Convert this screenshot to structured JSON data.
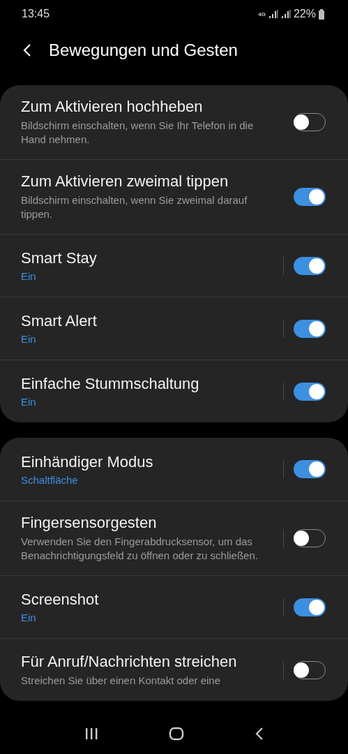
{
  "status_bar": {
    "time": "13:45",
    "network": "4G",
    "battery": "22%"
  },
  "header": {
    "title": "Bewegungen und Gesten"
  },
  "sections": [
    {
      "items": [
        {
          "kind": "plain",
          "title": "Zum Aktivieren hochheben",
          "description": "Bildschirm einschalten, wenn Sie Ihr Telefon in die Hand nehmen.",
          "on": false
        },
        {
          "kind": "plain",
          "title": "Zum Aktivieren zweimal tippen",
          "description": "Bildschirm einschalten, wenn Sie zweimal darauf tippen.",
          "on": true
        },
        {
          "kind": "link",
          "title": "Smart Stay",
          "status": "Ein",
          "on": true
        },
        {
          "kind": "link",
          "title": "Smart Alert",
          "status": "Ein",
          "on": true
        },
        {
          "kind": "link",
          "title": "Einfache Stummschaltung",
          "status": "Ein",
          "on": true
        }
      ]
    },
    {
      "items": [
        {
          "kind": "link",
          "title": "Einhändiger Modus",
          "status": "Schaltfläche",
          "on": true
        },
        {
          "kind": "link",
          "title": "Fingersensorgesten",
          "description": "Verwenden Sie den Fingerabdrucksensor, um das Benachrichtigungsfeld zu öffnen oder zu schließen.",
          "on": false
        },
        {
          "kind": "link",
          "title": "Screenshot",
          "status": "Ein",
          "on": true
        },
        {
          "kind": "link",
          "title": "Für Anruf/Nachrichten streichen",
          "description": "Streichen Sie über einen Kontakt oder eine",
          "on": false
        }
      ]
    }
  ]
}
